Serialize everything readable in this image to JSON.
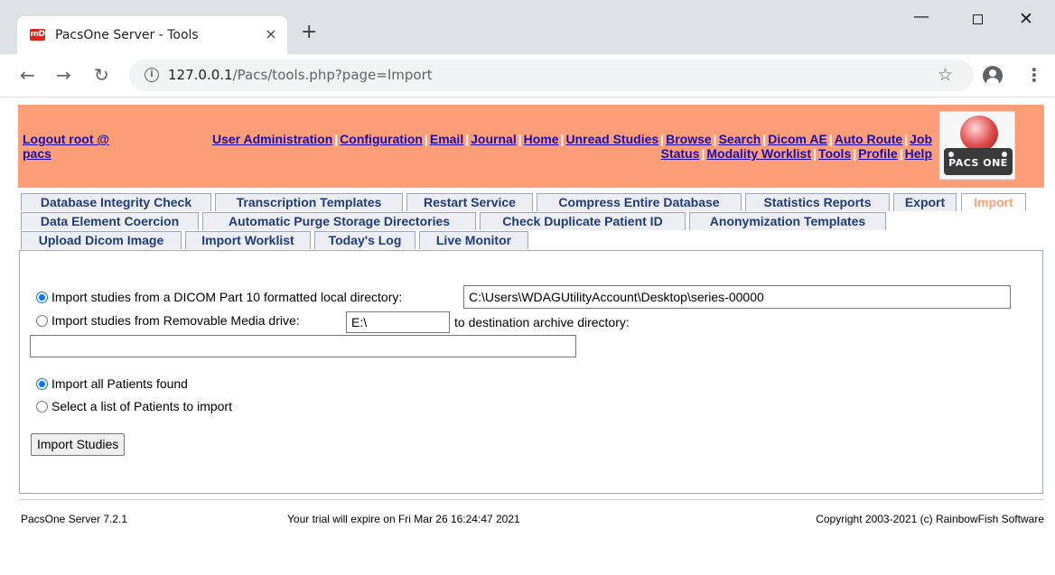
{
  "browser": {
    "tab_title": "PacsOne Server - Tools",
    "favicon_text": "mD",
    "close_glyph": "×",
    "new_tab_glyph": "+",
    "url_host": "127.0.0.1",
    "url_path": "/Pacs/tools.php?page=Import"
  },
  "header": {
    "logout_label": "Logout root @ pacs",
    "nav_links": [
      "User Administration",
      "Configuration",
      "Email",
      "Journal",
      "Home",
      "Unread Studies",
      "Browse",
      "Search",
      "Dicom AE",
      "Auto Route",
      "Job Status",
      "Modality Worklist",
      "Tools",
      "Profile",
      "Help"
    ],
    "logo_text": "PACS ONE"
  },
  "tabs": {
    "row1": [
      "Database Integrity Check",
      "Transcription Templates",
      "Restart Service",
      "Compress Entire Database",
      "Statistics Reports",
      "Export",
      "Import"
    ],
    "row2": [
      "Data Element Coercion",
      "Automatic Purge Storage Directories",
      "Check Duplicate Patient ID",
      "Anonymization Templates"
    ],
    "row3": [
      "Upload Dicom Image",
      "Import Worklist",
      "Today's Log",
      "Live Monitor"
    ],
    "active": "Import"
  },
  "form": {
    "source_local_label": "Import studies from a DICOM Part 10 formatted local directory:",
    "source_local_value": "C:\\Users\\WDAGUtilityAccount\\Desktop\\series-00000",
    "source_media_label": "Import studies from Removable Media drive:",
    "source_media_value": "E:\\",
    "destination_label": "to destination archive directory:",
    "destination_value": "",
    "source_selected": "local",
    "patients_all_label": "Import all Patients found",
    "patients_list_label": "Select a list of Patients to import",
    "patients_selected": "all",
    "submit_label": "Import Studies"
  },
  "footer": {
    "version": "PacsOne Server 7.2.1",
    "trial": "Your trial will expire on Fri Mar 26 16:24:47 2021",
    "copyright": "Copyright 2003-2021 (c) RainbowFish Software"
  }
}
